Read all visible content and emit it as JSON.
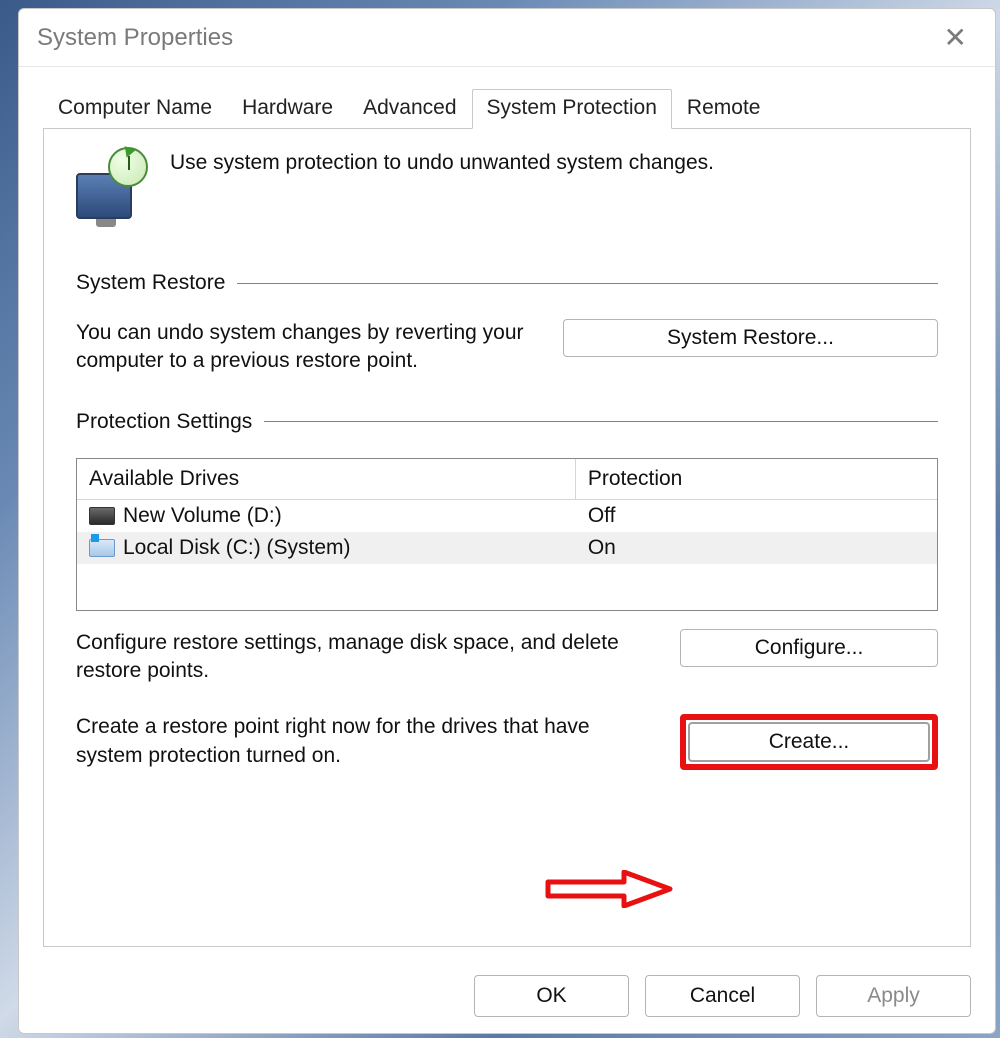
{
  "window": {
    "title": "System Properties"
  },
  "tabs": {
    "t0": "Computer Name",
    "t1": "Hardware",
    "t2": "Advanced",
    "t3": "System Protection",
    "t4": "Remote"
  },
  "intro": "Use system protection to undo unwanted system changes.",
  "restore": {
    "heading": "System Restore",
    "desc": "You can undo system changes by reverting your computer to a previous restore point.",
    "button": "System Restore..."
  },
  "protection": {
    "heading": "Protection Settings",
    "col_drive": "Available Drives",
    "col_protection": "Protection",
    "rows": [
      {
        "name": "New Volume (D:)",
        "status": "Off"
      },
      {
        "name": "Local Disk (C:) (System)",
        "status": "On"
      }
    ],
    "configure_desc": "Configure restore settings, manage disk space, and delete restore points.",
    "configure_button": "Configure...",
    "create_desc": "Create a restore point right now for the drives that have system protection turned on.",
    "create_button": "Create..."
  },
  "footer": {
    "ok": "OK",
    "cancel": "Cancel",
    "apply": "Apply"
  }
}
